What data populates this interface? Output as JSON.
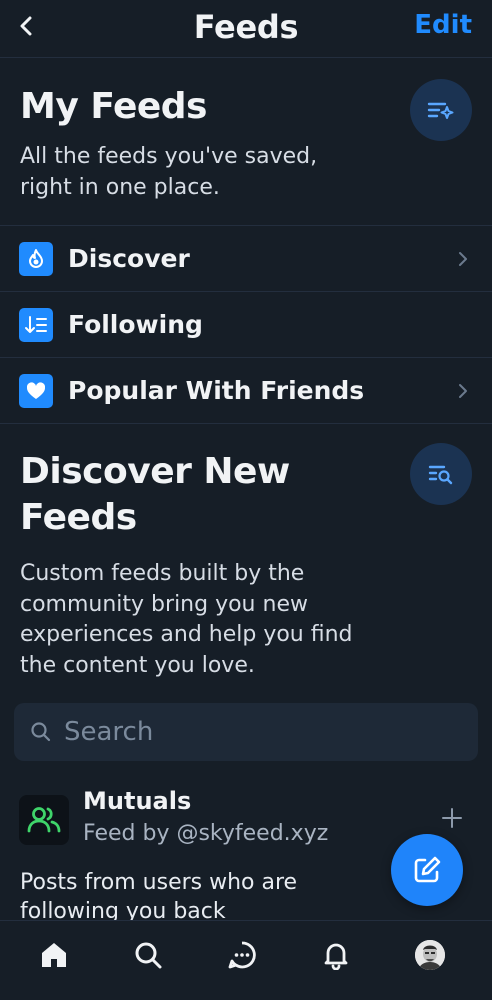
{
  "header": {
    "title": "Feeds",
    "edit_label": "Edit"
  },
  "my_feeds": {
    "title": "My Feeds",
    "description_line1": "All the feeds you've saved,",
    "description_line2": "right in one place.",
    "items": [
      {
        "label": "Discover",
        "icon": "flame-icon",
        "has_chevron": true
      },
      {
        "label": "Following",
        "icon": "sort-list-icon",
        "has_chevron": false
      },
      {
        "label": "Popular With Friends",
        "icon": "heart-icon",
        "has_chevron": true
      }
    ]
  },
  "discover": {
    "title_line1": "Discover New",
    "title_line2": "Feeds",
    "description_lines": [
      "Custom feeds built by the",
      "community bring you new",
      "experiences and help you find",
      "the content you love."
    ]
  },
  "search": {
    "placeholder": "Search"
  },
  "suggested_feed": {
    "name": "Mutuals",
    "byline": "Feed by @skyfeed.xyz",
    "description": "Posts from users who are following you back"
  },
  "bottom_nav": [
    "home-icon",
    "search-icon",
    "chat-icon",
    "bell-icon",
    "profile-avatar"
  ],
  "colors": {
    "background": "#161e27",
    "accent": "#208bfe",
    "divider": "#232e3e"
  }
}
